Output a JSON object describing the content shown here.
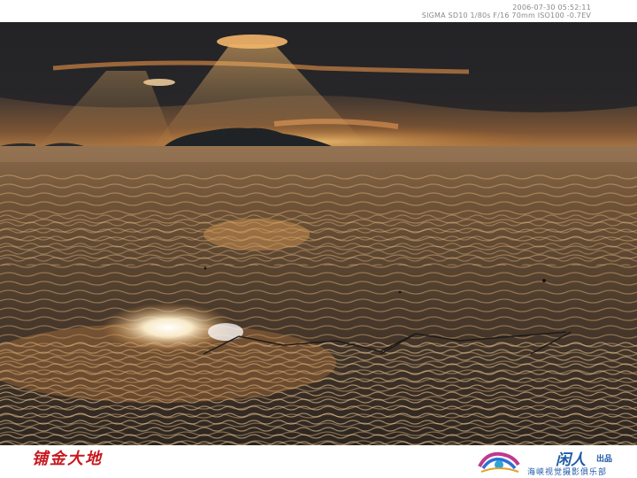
{
  "exif": {
    "datetime": "2006-07-30 05:52:11",
    "camera_settings": "SIGMA SD10 1/80s F/16 70mm ISO100 -0.7EV"
  },
  "caption": {
    "calligraphy_title": "铺金大地"
  },
  "logo": {
    "name": "闲人",
    "suffix": "出品",
    "club": "海峡视觉摄影俱乐部"
  },
  "colors": {
    "accent_red": "#c8191e",
    "logo_blue": "#1f5aa6"
  }
}
